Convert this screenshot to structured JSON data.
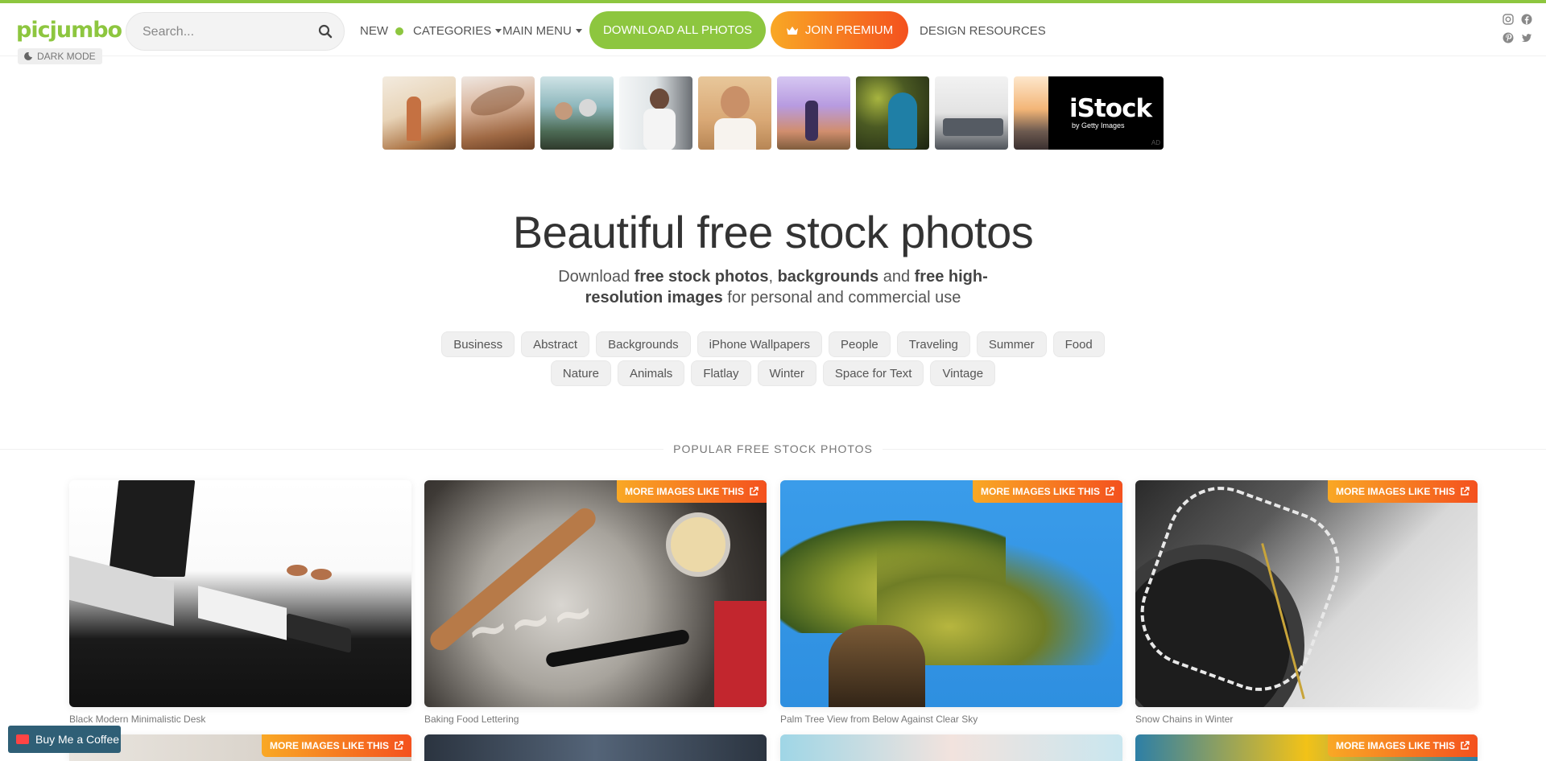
{
  "header": {
    "logo": "picjumbo",
    "dark_mode": "DARK MODE",
    "search_placeholder": "Search...",
    "nav_new": "NEW",
    "nav_categories": "CATEGORIES",
    "nav_main_menu": "MAIN MENU",
    "btn_download": "DOWNLOAD ALL PHOTOS",
    "btn_premium": "JOIN PREMIUM",
    "nav_design": "DESIGN RESOURCES"
  },
  "ad": {
    "brand": "iStock",
    "brand_sub": "by Getty Images",
    "ad_label": "AD"
  },
  "hero": {
    "title": "Beautiful free stock photos",
    "sub_1": "Download ",
    "sub_b1": "free stock photos",
    "sub_2": ", ",
    "sub_b2": "backgrounds",
    "sub_3": " and ",
    "sub_b3": "free high-resolution images",
    "sub_4": " for personal and commercial use"
  },
  "tags_row1": [
    "Business",
    "Abstract",
    "Backgrounds",
    "iPhone Wallpapers",
    "People",
    "Traveling",
    "Summer",
    "Food"
  ],
  "tags_row2": [
    "Nature",
    "Animals",
    "Flatlay",
    "Winter",
    "Space for Text",
    "Vintage"
  ],
  "popular": {
    "label": "POPULAR FREE STOCK PHOTOS",
    "more_label": "MORE IMAGES LIKE THIS",
    "cards": [
      {
        "caption": "Black Modern Minimalistic Desk"
      },
      {
        "caption": "Baking Food Lettering"
      },
      {
        "caption": "Palm Tree View from Below Against Clear Sky"
      },
      {
        "caption": "Snow Chains in Winter"
      }
    ]
  },
  "coffee": "Buy Me a Coffee",
  "colors": {
    "brand_green": "#8dc63f",
    "premium_orange": "#f4511e",
    "sky_blue": "#2e8fe0"
  }
}
